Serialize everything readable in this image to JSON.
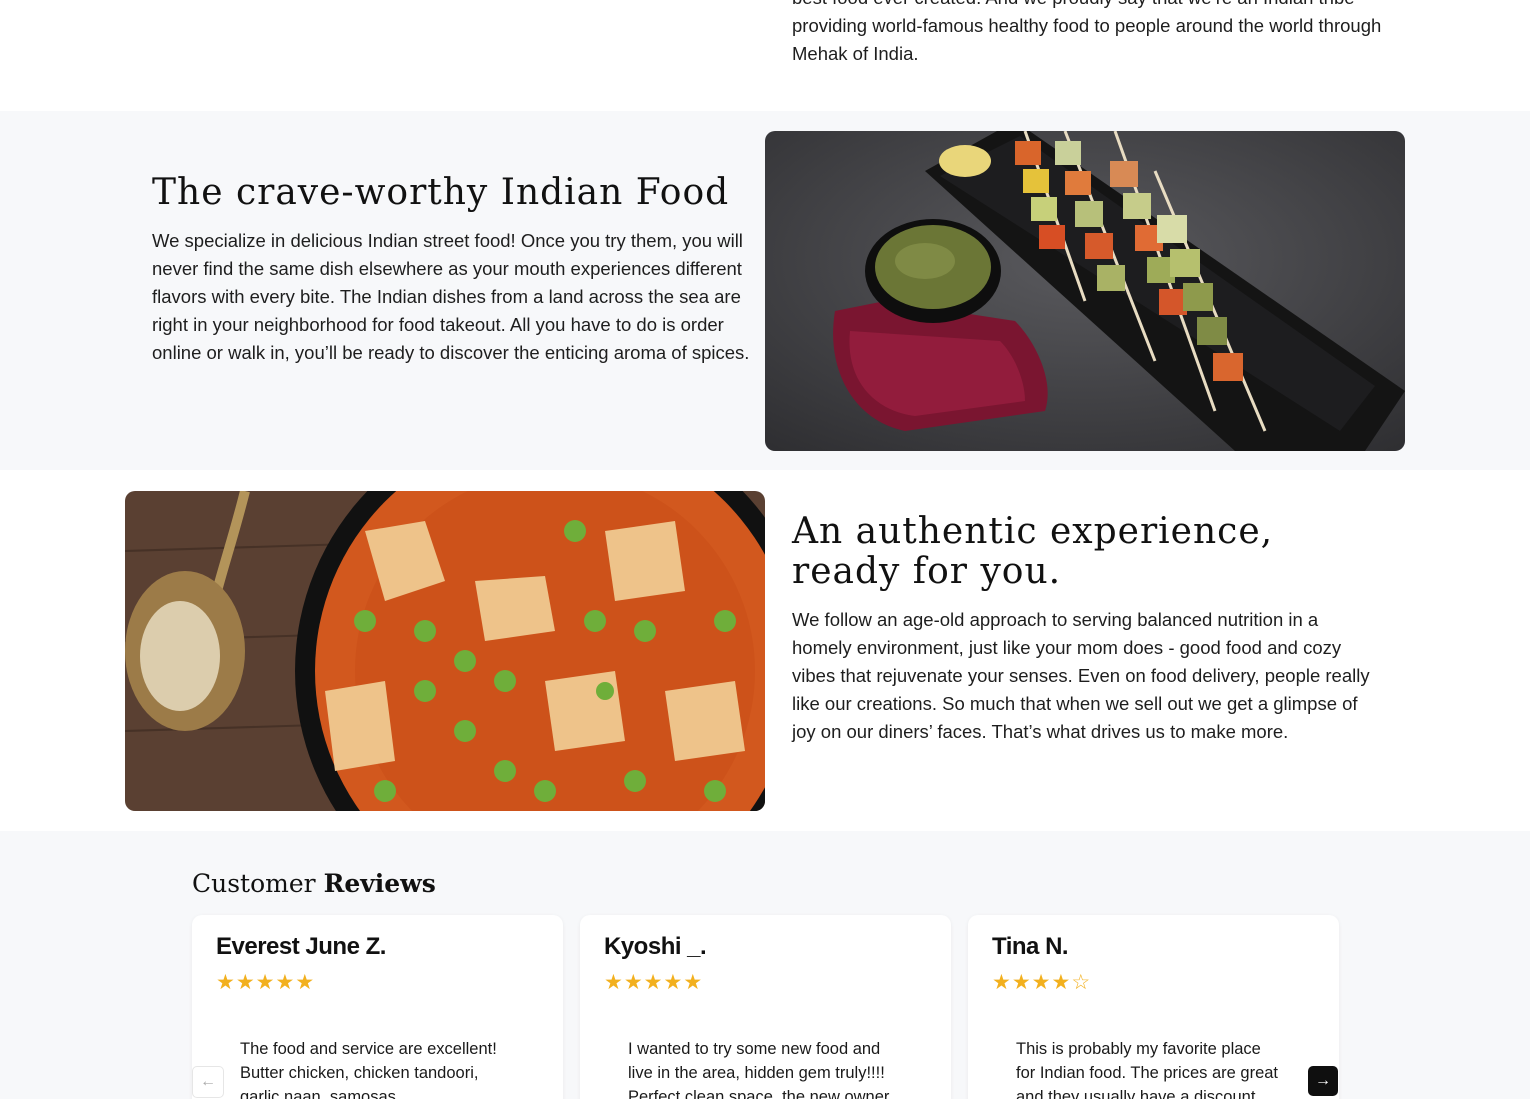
{
  "intro": {
    "text": "best food ever created. And we proudly say that we’re an Indian tribe providing world-famous healthy food to people around the world through Mehak of India."
  },
  "section_crave": {
    "title": "The crave-worthy Indian Food",
    "text": "We specialize in delicious Indian street food! Once you try them, you will never find the same dish elsewhere as your mouth experiences different flavors with every bite. The Indian dishes from a land across the sea are right in your neighborhood for food takeout. All you have to do is order online or walk in, you’ll be ready to discover the enticing aroma of spices."
  },
  "section_authentic": {
    "title": "An authentic experience, ready for you.",
    "text": "We follow an age-old approach to serving balanced nutrition in a homely environment, just like your mom does - good food and cozy vibes that rejuvenate your senses. Even on food delivery, people really like our creations. So much that when we sell out we get a glimpse of joy on our diners’ faces. That’s what drives us to make more."
  },
  "reviews": {
    "heading_light": "Customer",
    "heading_bold": "Reviews",
    "items": [
      {
        "name": "Everest June Z.",
        "rating": 5,
        "text": "The food and service are excellent! Butter chicken, chicken tandoori, garlic naan, samosas"
      },
      {
        "name": "Kyoshi _.",
        "rating": 5,
        "text": "I wanted to try some new food and live in the area, hidden gem truly!!!! Perfect clean space, the new owner"
      },
      {
        "name": "Tina N.",
        "rating": 4,
        "text": "This is probably my favorite place for Indian food. The prices are great and they usually have a discount when"
      }
    ],
    "prev_icon": "arrow-left-icon",
    "next_icon": "arrow-right-icon"
  },
  "colors": {
    "star": "#f2b01e",
    "band_bg": "#f7f8fa",
    "next_button_bg": "#0f0f0f"
  }
}
